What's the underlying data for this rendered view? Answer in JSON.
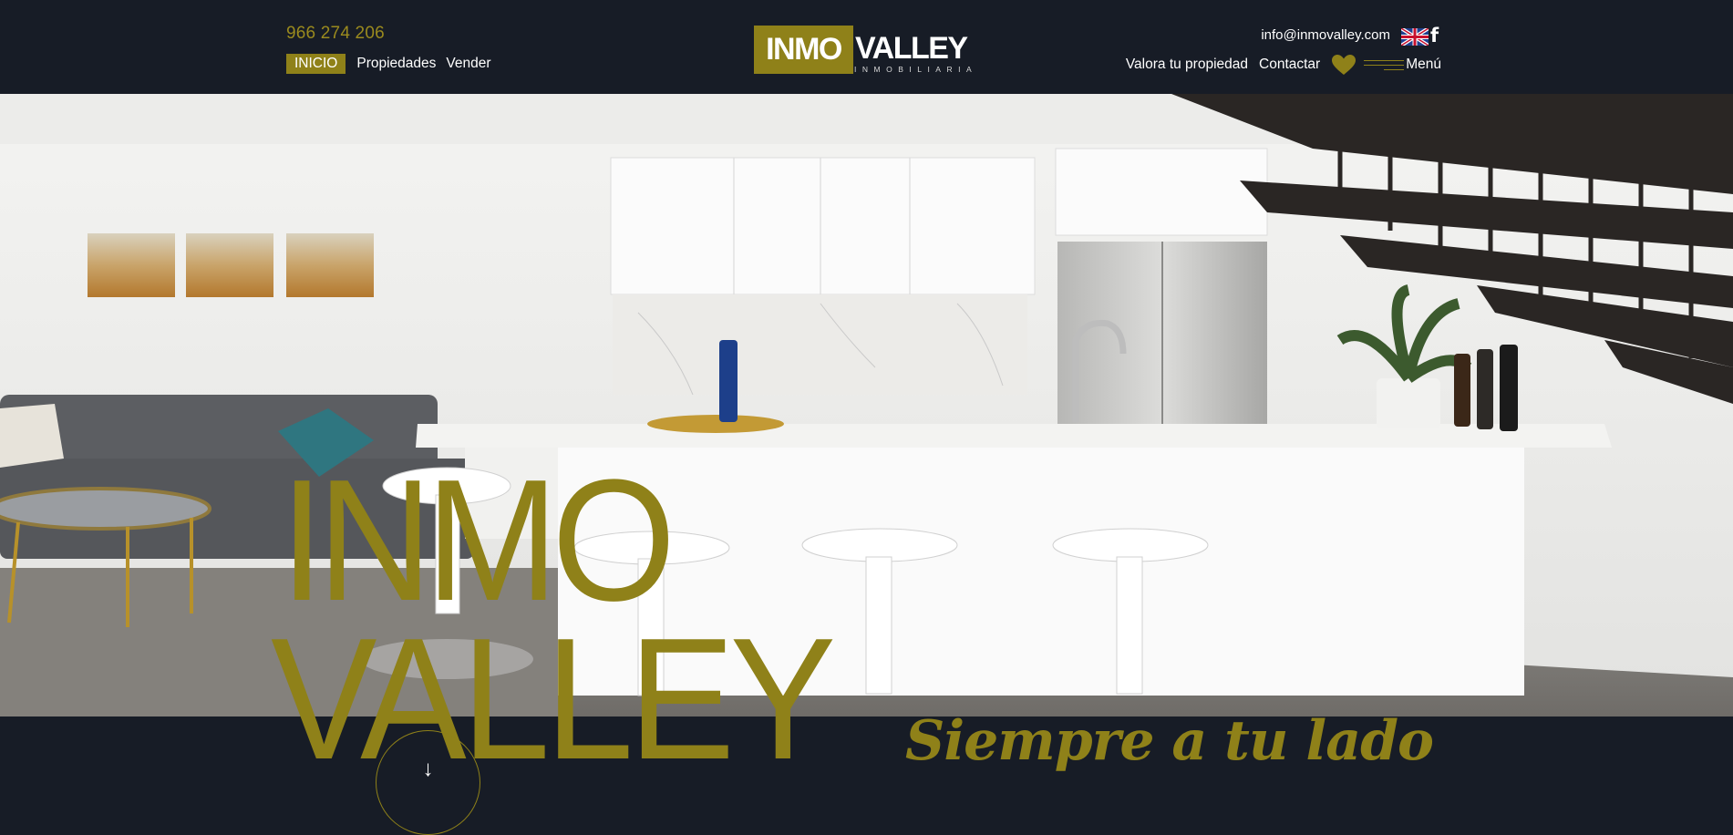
{
  "header": {
    "phone": "966 274 206",
    "email": "info@inmovalley.com",
    "nav_left": [
      {
        "label": "INICIO",
        "active": true
      },
      {
        "label": "Propiedades",
        "active": false
      },
      {
        "label": "Vender",
        "active": false
      }
    ],
    "logo": {
      "part1": "INMO",
      "part2": "VALLEY",
      "subtitle": "INMOBILIARIA"
    },
    "nav_right": [
      {
        "label": "Valora tu propiedad"
      },
      {
        "label": "Contactar"
      }
    ],
    "menu_label": "Menú",
    "social_icon": "facebook-icon",
    "language_icon": "uk-flag-icon"
  },
  "hero": {
    "big_title_line1": "INMO",
    "big_title_line2": "VALLEY",
    "tagline": "Siempre a tu lado",
    "scroll_arrow": "↓",
    "image_description_icon": "kitchen-photo"
  },
  "colors": {
    "brand_gold": "#8f8119",
    "dark_bg": "#171c26",
    "text": "#ffffff"
  }
}
